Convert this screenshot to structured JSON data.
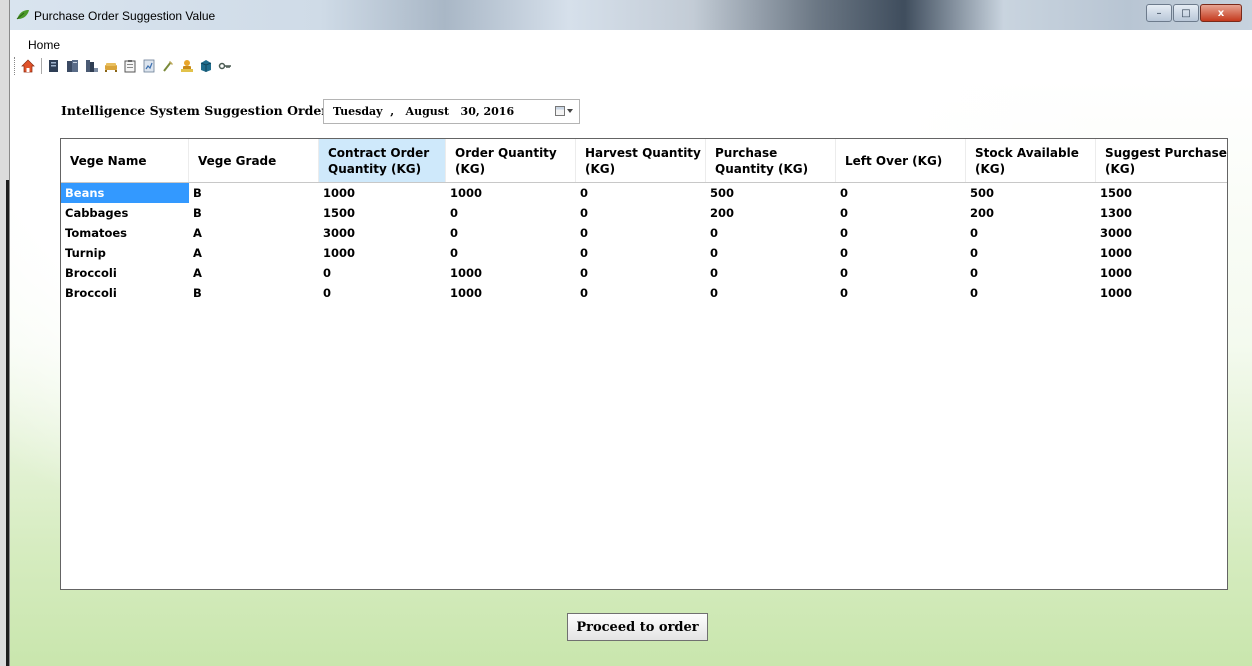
{
  "window": {
    "title": "Purchase Order Suggestion Value",
    "controls": {
      "minimize": "–",
      "maximize": "□",
      "close": "x"
    }
  },
  "menu": {
    "home": "Home"
  },
  "toolbar": {
    "icons": [
      "home-icon",
      "document-icon",
      "book-stack-icon",
      "books-icon",
      "sofa-icon",
      "clipboard-icon",
      "report-icon",
      "brush-icon",
      "worker-icon",
      "box-icon",
      "key-icon"
    ]
  },
  "heading": "Intelligence System Suggestion Order",
  "date_picker": {
    "value": "Tuesday  ,   August   30, 2016"
  },
  "grid": {
    "columns": [
      "Vege Name",
      "Vege Grade",
      "Contract Order Quantity (KG)",
      "Order Quantity (KG)",
      "Harvest Quantity (KG)",
      "Purchase Quantity (KG)",
      "Left Over (KG)",
      "Stock Available (KG)",
      "Suggest Purchase (KG)"
    ],
    "sorted_column": "Contract Order Quantity (KG)",
    "selected_row": 0,
    "rows": [
      [
        "Beans",
        "B",
        "1000",
        "1000",
        "0",
        "500",
        "0",
        "500",
        "1500"
      ],
      [
        "Cabbages",
        "B",
        "1500",
        "0",
        "0",
        "200",
        "0",
        "200",
        "1300"
      ],
      [
        "Tomatoes",
        "A",
        "3000",
        "0",
        "0",
        "0",
        "0",
        "0",
        "3000"
      ],
      [
        "Turnip",
        "A",
        "1000",
        "0",
        "0",
        "0",
        "0",
        "0",
        "1000"
      ],
      [
        "Broccoli",
        "A",
        "0",
        "1000",
        "0",
        "0",
        "0",
        "0",
        "1000"
      ],
      [
        "Broccoli",
        "B",
        "0",
        "1000",
        "0",
        "0",
        "0",
        "0",
        "1000"
      ]
    ]
  },
  "proceed_button": "Proceed to order",
  "colors": {
    "selection": "#3399ff",
    "sorted_header": "#cfe9fb",
    "background_green": "#c9e6ad"
  }
}
